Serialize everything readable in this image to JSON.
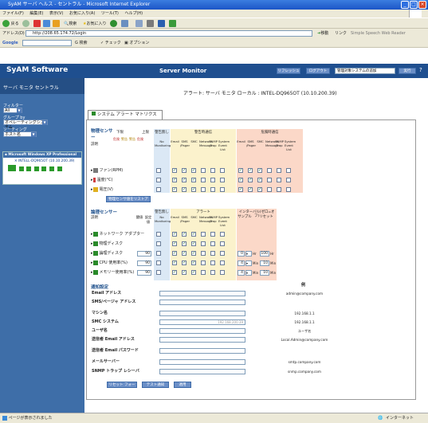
{
  "window": {
    "title": "SyAM サーバ ヘルス - セントラル - Microsoft Internet Explorer"
  },
  "menu": [
    "ファイル(F)",
    "編集(E)",
    "表示(V)",
    "お気に入り(A)",
    "ツール(T)",
    "ヘルプ(H)"
  ],
  "toolbar": {
    "back": "戻る",
    "search": "検索",
    "favorites": "お気に入り"
  },
  "address": {
    "label": "アドレス(D)",
    "url": "http://208.65.174.72/Login",
    "go": "移動",
    "links": "リンク",
    "speech": "Simple Speech Web Reader"
  },
  "googlebar": {
    "label": "Google",
    "search": "検索",
    "check": "チェック",
    "options": "オプション"
  },
  "app": {
    "logo": "SyAM Software",
    "title": "Server Monitor",
    "btn_refresh": "リフレッシュ",
    "btn_logout": "ログアウト",
    "select_label": "管理対象システムの追加",
    "btn_run": "実行",
    "help": "?"
  },
  "sidebar": {
    "header": "サーバ モニタ セントラル",
    "filter_label": "フィルター",
    "filter_value": "All",
    "group_label": "グループ by",
    "group_value": "オペレーティングシステム",
    "sort_label": "ソーティング",
    "sort_value": "ホスト名",
    "os_group": "Microsoft Windows XP Professional",
    "host": "INTELL-DQ965OT (10.10.200.39)"
  },
  "main": {
    "heading": "アラート: サーバ モニタ ローカル : INTEL-DQ965OT (10.10.200.39)",
    "tab": "システム アラート マトリクス",
    "physical": {
      "title": "物理センサー",
      "desc": "説明",
      "lower": "下限",
      "upper": "上限",
      "lower_levels": [
        "危険",
        "警告",
        "警告",
        "危険"
      ],
      "no_alert": "警告無し",
      "warn": "警告時通信",
      "crit": "危険時通信",
      "cols": [
        "No Monitoring",
        "Email",
        "SMS /Pager",
        "SMC",
        "Network Message",
        "SNMP Trap",
        "System Event List",
        "Email",
        "SMS /Pager",
        "SMC",
        "Network Message",
        "SNMP Trap",
        "System Event List"
      ],
      "rows": [
        "ファン(RPM)",
        "温度(°C)",
        "電圧(V)"
      ],
      "restore_button": "物理センサ値をリストア"
    },
    "logical": {
      "title": "論理センサー",
      "desc": "説明",
      "col_threshold": "閾値",
      "col_setting": "設定値",
      "no_alert": "警告無し",
      "alert": "アラート",
      "interval": "インターバル(ゼロ=オフ)",
      "cols": [
        "No Monitoring",
        "Email",
        "SMS /Pager",
        "SMC",
        "Network Message",
        "SNMP Trap",
        "System Event List"
      ],
      "sample": "サンプル",
      "reset": "リセット",
      "rows": [
        {
          "label": "ネットワーク アダプター",
          "threshold": ""
        },
        {
          "label": "物理ディスク",
          "threshold": ""
        },
        {
          "label": "論理ディスク",
          "threshold": "90",
          "sample": "0",
          "unit": "Hr",
          "reset": "100",
          "reset_unit": "Hr"
        },
        {
          "label": "CPU 使用率(%)",
          "threshold": "90",
          "sample": "4",
          "unit": "Min",
          "reset": "10",
          "reset_unit": "Min"
        },
        {
          "label": "メモリー使用率(%)",
          "threshold": "90",
          "sample": "4",
          "unit": "Min",
          "reset": "10",
          "reset_unit": "Min"
        }
      ]
    },
    "notify": {
      "title": "通知設定",
      "example_header": "例",
      "fields": [
        {
          "label": "Email アドレス",
          "example": "admin@company.com"
        },
        {
          "label": "SMS/ページャ アドレス",
          "example": ""
        },
        {
          "label": "マシン名",
          "example": "192.168.1.1"
        },
        {
          "label": "SMC システム",
          "example": "192.168.1.1",
          "value": "192.168.200.39"
        },
        {
          "label": "ユーザ名",
          "example": "ユーザ名"
        },
        {
          "label": "送信者 Email アドレス",
          "example": "Local.Admin@company.com"
        },
        {
          "label": "送信者 Email パスワード",
          "example": ""
        },
        {
          "label": "メールサーバー",
          "example": "smtp.company.com"
        },
        {
          "label": "SNMP トラップ レシーバ",
          "example": "snmp.company.com"
        }
      ],
      "btn_reset": "リセット フォーム",
      "btn_test": "テスト通知",
      "btn_apply": "適用"
    }
  },
  "status": {
    "text": "ページが表示されました",
    "zone": "インターネット"
  }
}
